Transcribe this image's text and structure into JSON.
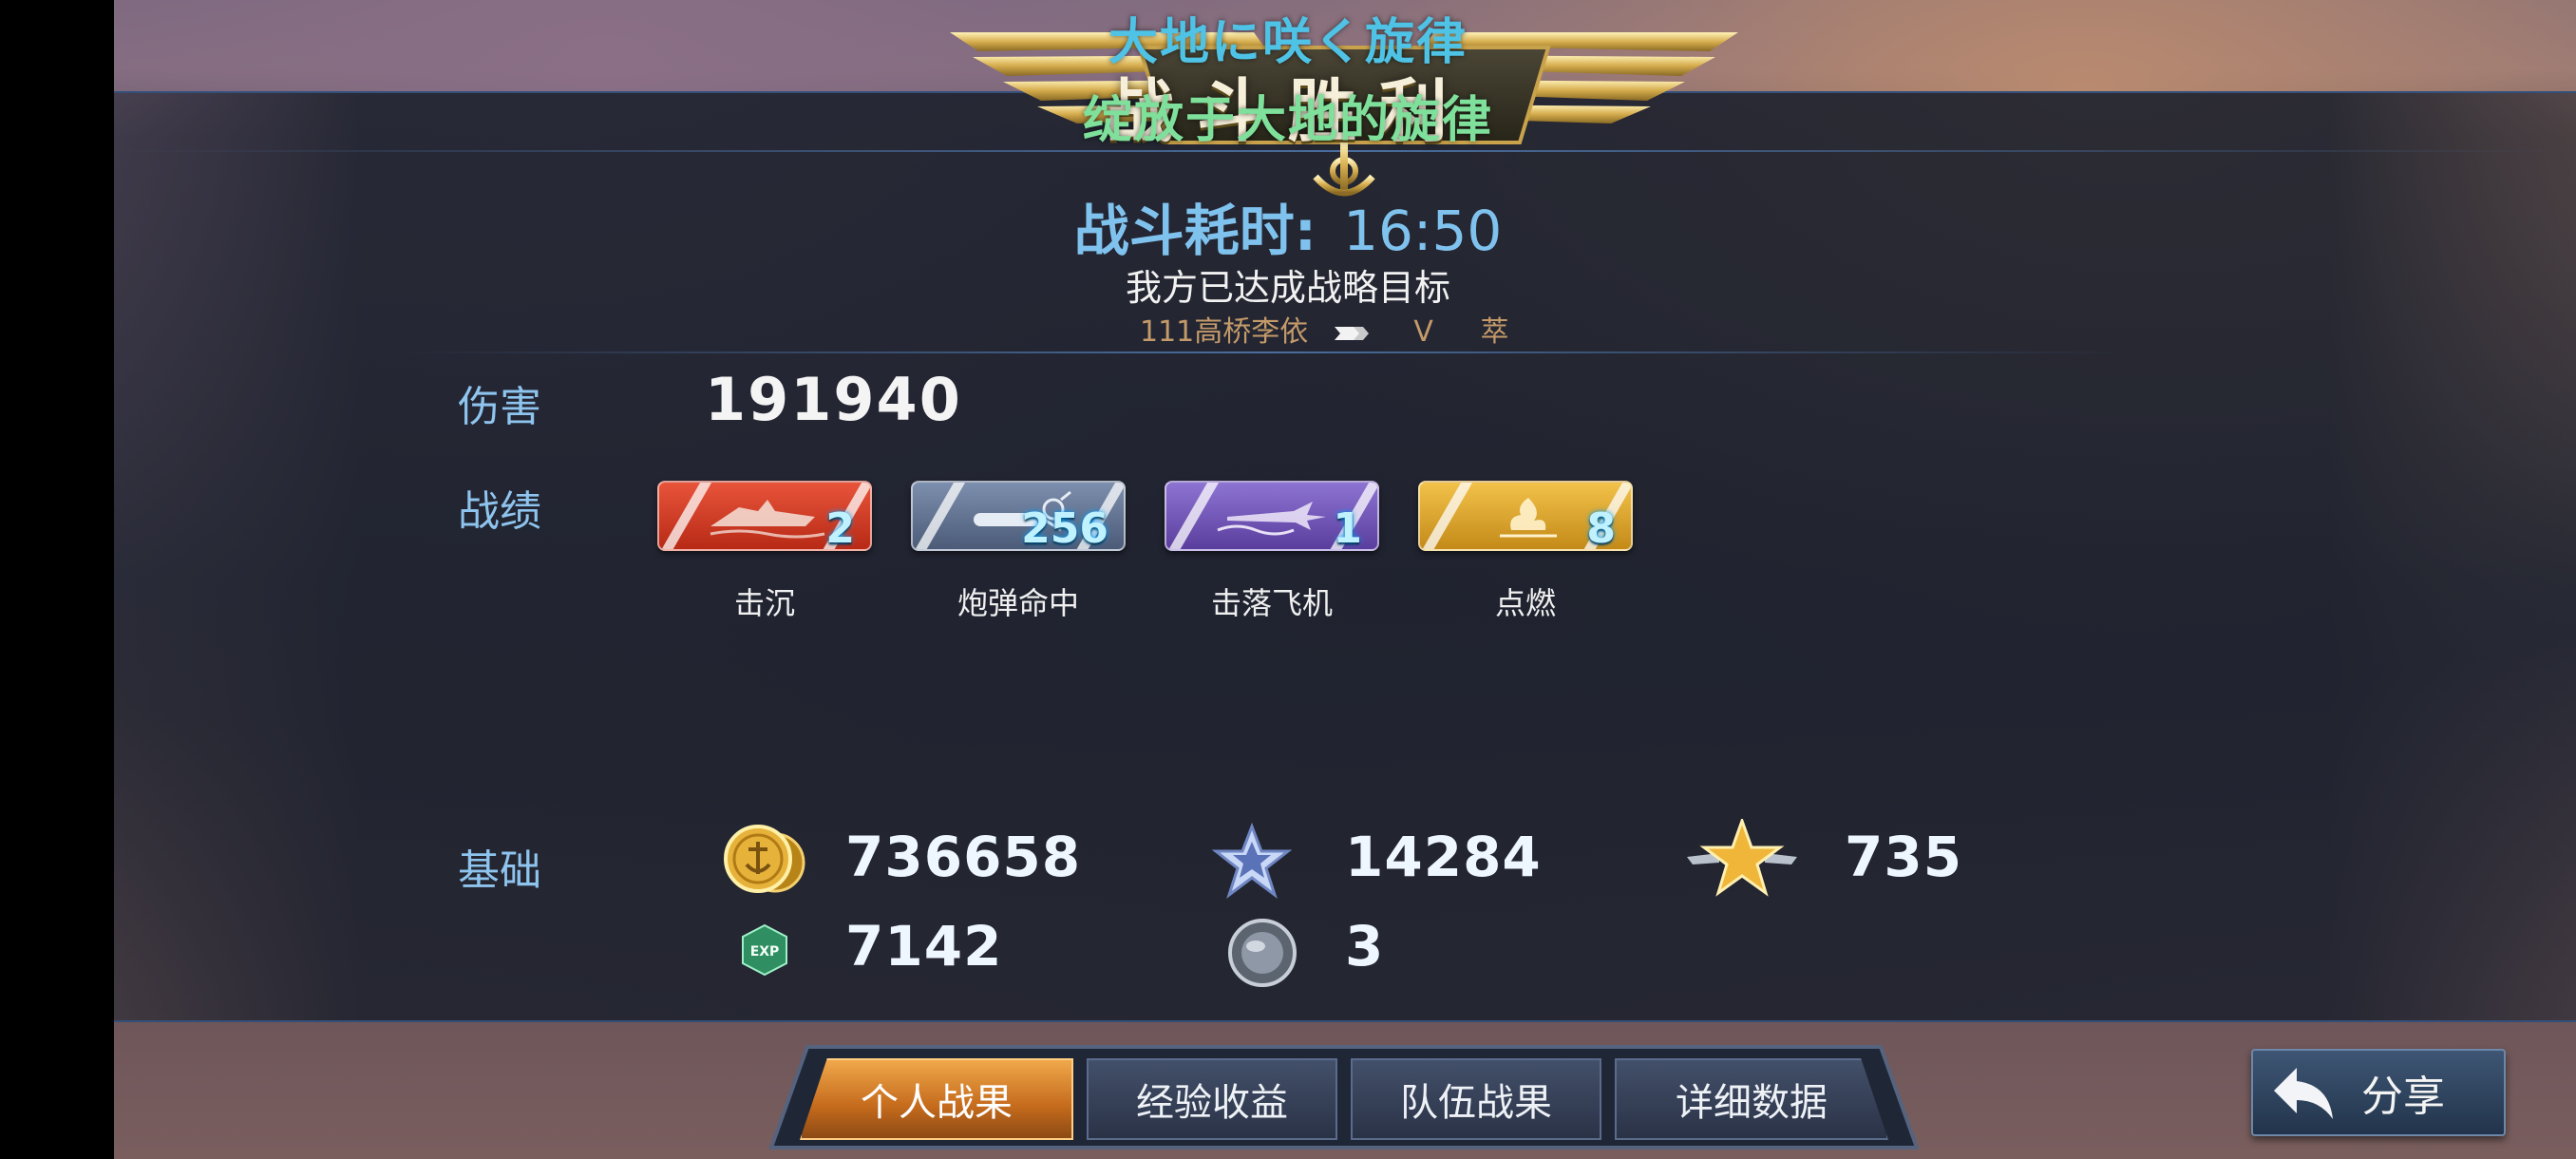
{
  "overlay": {
    "lyric_japanese": "大地に咲く旋律",
    "lyric_chinese": "绽放于大地的旋律"
  },
  "result": {
    "banner_title": "战斗胜利",
    "battle_time_label": "战斗耗时:",
    "battle_time_value": "16:50",
    "status_text": "我方已达成战略目标",
    "players": [
      "111高桥李依",
      "V",
      "萃"
    ]
  },
  "damage": {
    "label": "伤害",
    "value": "191940"
  },
  "achievements": {
    "label": "战绩",
    "items": [
      {
        "name": "击沉",
        "count": "2",
        "color": "#d23a22",
        "icon": "sinking-ship-icon"
      },
      {
        "name": "炮弹命中",
        "count": "256",
        "color": "#5d6f8c",
        "icon": "shell-hit-icon"
      },
      {
        "name": "击落飞机",
        "count": "1",
        "color": "#6a4fb0",
        "icon": "downed-plane-icon"
      },
      {
        "name": "点燃",
        "count": "8",
        "color": "#d6a22c",
        "icon": "fire-icon"
      }
    ]
  },
  "rewards": {
    "label": "基础",
    "gold": "736658",
    "blue_star": "14284",
    "gold_star": "735",
    "exp": "7142",
    "globe": "3",
    "exp_icon_text": "EXP"
  },
  "tabs": [
    {
      "label": "个人战果",
      "active": true
    },
    {
      "label": "经验收益",
      "active": false
    },
    {
      "label": "队伍战果",
      "active": false
    },
    {
      "label": "详细数据",
      "active": false
    }
  ],
  "share": {
    "label": "分享"
  },
  "colors": {
    "accent_blue": "#7fc2ee",
    "label_blue": "#8ec4ee",
    "active_tab": "#e08a30"
  }
}
